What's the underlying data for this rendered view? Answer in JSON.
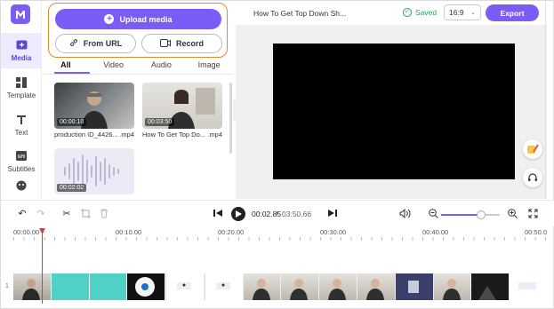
{
  "rail": {
    "items": [
      {
        "label": "Media",
        "icon": "media-icon",
        "active": true
      },
      {
        "label": "Template",
        "icon": "template-icon"
      },
      {
        "label": "Text",
        "icon": "text-icon"
      },
      {
        "label": "Subtitles",
        "icon": "subtitles-icon"
      },
      {
        "label": "",
        "icon": "stickers-icon"
      }
    ]
  },
  "media": {
    "upload_label": "Upload media",
    "from_url_label": "From URL",
    "record_label": "Record",
    "tabs": [
      "All",
      "Video",
      "Audio",
      "Image"
    ],
    "active_tab": "All",
    "items": [
      {
        "duration": "00:00:10",
        "name_left": "production ID_4426...",
        "name_right": ".mp4"
      },
      {
        "duration": "00:03:50",
        "name_left": "How To Get Top Do...",
        "name_right": ".mp4"
      },
      {
        "duration": "00:02:02",
        "name_left": "",
        "name_right": ""
      }
    ]
  },
  "topbar": {
    "title": "How To Get Top Down Sh...",
    "saved_label": "Saved",
    "aspect_ratio": "16:9",
    "export_label": "Export"
  },
  "controls": {
    "current_time": "00:02.85",
    "separator": "/",
    "total_time": "03:50.66"
  },
  "timeline": {
    "ruler_labels": [
      "00:00.00",
      "00:10.00",
      "00:20.00",
      "00:30.00",
      "00:40.00",
      "00:50.0"
    ],
    "track_number": "1",
    "zoom_level": 0.68
  },
  "colors": {
    "accent": "#7b5cf6",
    "highlight_border": "#e08b2e",
    "saved_green": "#2fa25b",
    "playhead": "#e53935"
  }
}
